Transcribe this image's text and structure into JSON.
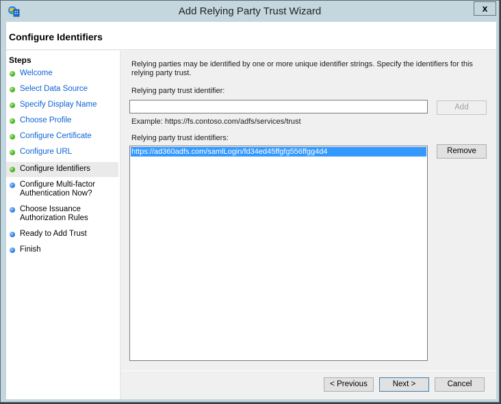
{
  "window": {
    "title": "Add Relying Party Trust Wizard",
    "close_label": "x"
  },
  "header": {
    "title": "Configure Identifiers"
  },
  "steps": {
    "heading": "Steps",
    "items": [
      {
        "label": "Welcome",
        "status": "completed"
      },
      {
        "label": "Select Data Source",
        "status": "completed"
      },
      {
        "label": "Specify Display Name",
        "status": "completed"
      },
      {
        "label": "Choose Profile",
        "status": "completed"
      },
      {
        "label": "Configure Certificate",
        "status": "completed"
      },
      {
        "label": "Configure URL",
        "status": "completed"
      },
      {
        "label": "Configure Identifiers",
        "status": "current"
      },
      {
        "label": "Configure Multi-factor Authentication Now?",
        "status": "pending"
      },
      {
        "label": "Choose Issuance Authorization Rules",
        "status": "pending"
      },
      {
        "label": "Ready to Add Trust",
        "status": "pending"
      },
      {
        "label": "Finish",
        "status": "pending"
      }
    ]
  },
  "main": {
    "description": "Relying parties may be identified by one or more unique identifier strings. Specify the identifiers for this relying party trust.",
    "identifier_label": "Relying party trust identifier:",
    "identifier_value": "",
    "add_label": "Add",
    "example_text": "Example: https://fs.contoso.com/adfs/services/trust",
    "identifiers_label": "Relying party trust identifiers:",
    "identifiers": [
      "https://ad360adfs.com/samlLogin/fd34ed45ffgfg556ffgg4d4"
    ],
    "remove_label": "Remove"
  },
  "footer": {
    "previous_label": "< Previous",
    "next_label": "Next >",
    "cancel_label": "Cancel"
  },
  "colors": {
    "completed_dot": "#3fae1c",
    "pending_dot": "#2c7be0",
    "link": "#0b62d6",
    "selection": "#3399ff"
  }
}
